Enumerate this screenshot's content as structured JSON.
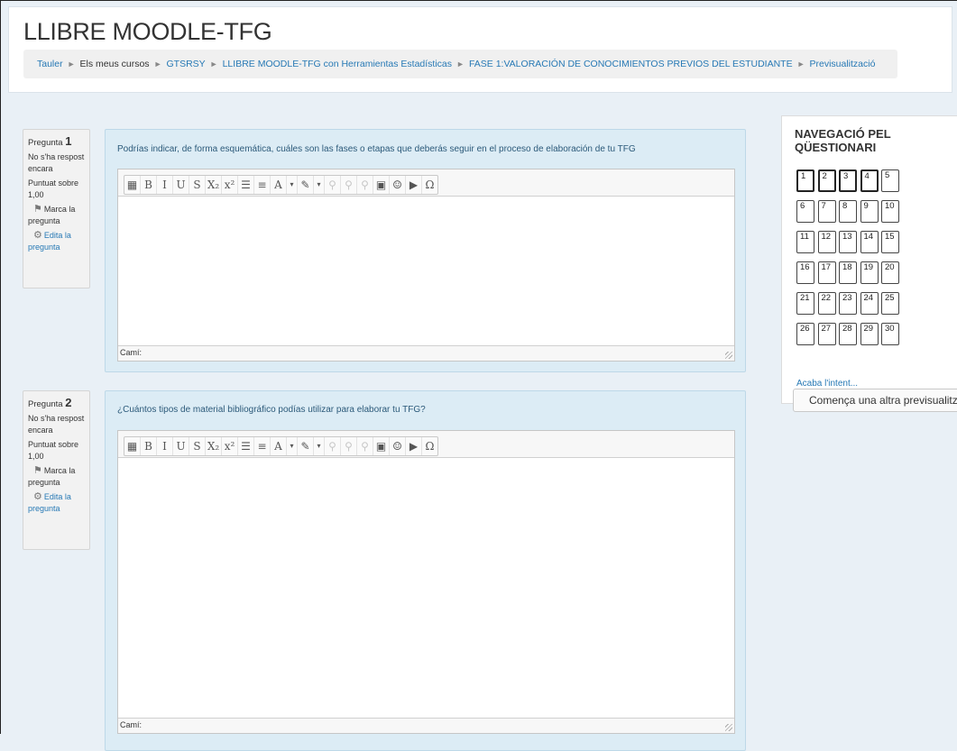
{
  "site": {
    "title": "LLIBRE MOODLE-TFG"
  },
  "breadcrumb": [
    {
      "label": "Tauler",
      "link": true
    },
    {
      "label": "Els meus cursos",
      "link": false
    },
    {
      "label": "GTSRSY",
      "link": true
    },
    {
      "label": "LLIBRE MOODLE-TFG con Herramientas Estadísticas",
      "link": true
    },
    {
      "label": "FASE 1:VALORACIÓN DE CONOCIMIENTOS PREVIOS DEL ESTUDIANTE",
      "link": true
    },
    {
      "label": "Previsualització",
      "link": true
    }
  ],
  "breadcrumb_separator": "►",
  "questions": [
    {
      "label": "Pregunta",
      "number": "1",
      "status_line1": "No s'ha respost",
      "status_line2": "encara",
      "grade_line1": "Puntuat sobre",
      "grade_line2": "1,00",
      "flag_line1": "Marca la",
      "flag_line2": "pregunta",
      "edit_line1": "Edita la",
      "edit_line2": "pregunta",
      "text": "Podrías indicar, de forma esquemática, cuáles son las fases o etapas que deberás seguir en el proceso de elaboración de tu TFG",
      "path_label": "Camí:"
    },
    {
      "label": "Pregunta",
      "number": "2",
      "status_line1": "No s'ha respost",
      "status_line2": "encara",
      "grade_line1": "Puntuat sobre",
      "grade_line2": "1,00",
      "flag_line1": "Marca la",
      "flag_line2": "pregunta",
      "edit_line1": "Edita la",
      "edit_line2": "pregunta",
      "text": "¿Cuántos tipos de material bibliográfico podías utilizar para elaborar tu TFG?",
      "path_label": "Camí:"
    }
  ],
  "toolbar": {
    "buttons": [
      {
        "name": "toggle-toolbar-icon",
        "glyph": "▦",
        "enabled": true
      },
      {
        "name": "bold-icon",
        "glyph": "B",
        "enabled": true
      },
      {
        "name": "italic-icon",
        "glyph": "I",
        "enabled": true
      },
      {
        "name": "underline-icon",
        "glyph": "U",
        "enabled": true
      },
      {
        "name": "strikethrough-icon",
        "glyph": "S",
        "enabled": true
      },
      {
        "name": "subscript-icon",
        "glyph": "X₂",
        "enabled": true
      },
      {
        "name": "superscript-icon",
        "glyph": "x²",
        "enabled": true
      },
      {
        "name": "bullet-list-icon",
        "glyph": "☰",
        "enabled": true
      },
      {
        "name": "numbered-list-icon",
        "glyph": "≡",
        "enabled": true
      },
      {
        "name": "text-color-icon",
        "glyph": "A",
        "enabled": true
      },
      {
        "name": "text-color-dropdown-icon",
        "glyph": "▾",
        "enabled": true,
        "drop": true
      },
      {
        "name": "background-color-icon",
        "glyph": "✎",
        "enabled": true
      },
      {
        "name": "background-color-dropdown-icon",
        "glyph": "▾",
        "enabled": true,
        "drop": true
      },
      {
        "name": "link-icon",
        "glyph": "⚲",
        "enabled": false
      },
      {
        "name": "unlink-icon",
        "glyph": "⚲",
        "enabled": false
      },
      {
        "name": "anchor-icon",
        "glyph": "⚲",
        "enabled": false
      },
      {
        "name": "image-icon",
        "glyph": "▣",
        "enabled": true
      },
      {
        "name": "emoticon-icon",
        "glyph": "☺",
        "enabled": true
      },
      {
        "name": "media-icon",
        "glyph": "▶",
        "enabled": true
      },
      {
        "name": "special-char-icon",
        "glyph": "Ω",
        "enabled": true
      }
    ]
  },
  "quiz_nav": {
    "title_line1": "NAVEGACIÓ PEL",
    "title_line2": "QÜESTIONARI",
    "buttons": [
      "1",
      "2",
      "3",
      "4",
      "5",
      "6",
      "7",
      "8",
      "9",
      "10",
      "11",
      "12",
      "13",
      "14",
      "15",
      "16",
      "17",
      "18",
      "19",
      "20",
      "21",
      "22",
      "23",
      "24",
      "25",
      "26",
      "27",
      "28",
      "29",
      "30"
    ],
    "finish_link": "Acaba l'intent...",
    "preview_button": "Comença una altra previsualització"
  }
}
